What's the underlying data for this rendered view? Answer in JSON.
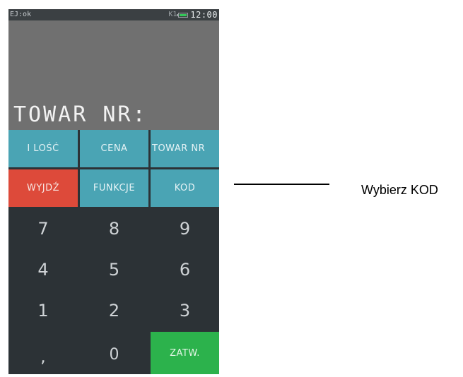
{
  "status_bar": {
    "left_text": "EJ:ok",
    "indicator": "K1",
    "battery_icon": "battery-icon",
    "clock": "12:00"
  },
  "display": {
    "prompt": "TOWAR NR:"
  },
  "function_keys": {
    "row1": [
      "I LOŚĆ",
      "CENA",
      "TOWAR NR"
    ],
    "row2": [
      "WYJDŹ",
      "FUNKCJE",
      "KOD"
    ]
  },
  "numpad": {
    "row1": [
      "7",
      "8",
      "9"
    ],
    "row2": [
      "4",
      "5",
      "6"
    ],
    "row3": [
      "1",
      "2",
      "3"
    ],
    "row4": [
      ",",
      "0"
    ],
    "confirm": "ZATW."
  },
  "annotation": {
    "text": "Wybierz KOD"
  },
  "colors": {
    "function_key": "#4aa4b4",
    "exit_key": "#dd4a3a",
    "confirm_key": "#2cb24c",
    "numpad_bg": "#2c3236",
    "display_bg": "#707070"
  }
}
